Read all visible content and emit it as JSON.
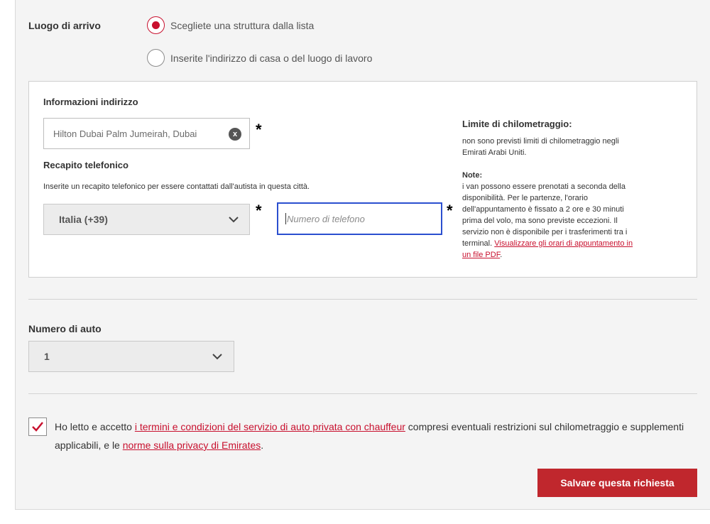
{
  "arrival": {
    "label": "Luogo di arrivo",
    "options": [
      {
        "label": "Scegliete una struttura dalla lista",
        "selected": true
      },
      {
        "label": "Inserite l'indirizzo di casa o del luogo di lavoro",
        "selected": false
      }
    ]
  },
  "address_box": {
    "info_heading": "Informazioni indirizzo",
    "address_value": "Hilton Dubai Palm Jumeirah, Dubai",
    "clear_icon": "x",
    "required_mark": "*",
    "phone_heading": "Recapito telefonico",
    "phone_description": "Inserite un recapito telefonico per essere contattati dall'autista in questa città.",
    "country_value": "Italia (+39)",
    "phone_placeholder": "Numero di telefono",
    "side": {
      "title": "Limite di chilometraggio:",
      "text": "non sono previsti limiti di chilometraggio negli Emirati Arabi Uniti.",
      "note_heading": "Note:",
      "note_text": "i van possono essere prenotati a seconda della disponibilità. Per le partenze, l'orario dell'appuntamento è fissato a 2 ore e 30 minuti prima del volo, ma sono previste eccezioni. Il servizio non è disponibile per i trasferimenti tra i terminal. ",
      "note_link": "Visualizzare gli orari di appuntamento in un file PDF",
      "note_end": "."
    }
  },
  "cars": {
    "label": "Numero di auto",
    "value": "1"
  },
  "terms": {
    "checked": true,
    "text_1": "Ho letto e accetto ",
    "link_1": "i termini e condizioni del servizio di auto privata con chauffeur",
    "text_2": " compresi eventuali restrizioni sul chilometraggio e supplementi applicabili, e le ",
    "link_2": "norme sulla privacy di Emirates",
    "text_3": "."
  },
  "save_button": "Salvare questa richiesta",
  "colors": {
    "accent": "#c8102e",
    "button": "#c0272d",
    "focus": "#2b4fcf",
    "panel": "#f4f4f4"
  }
}
